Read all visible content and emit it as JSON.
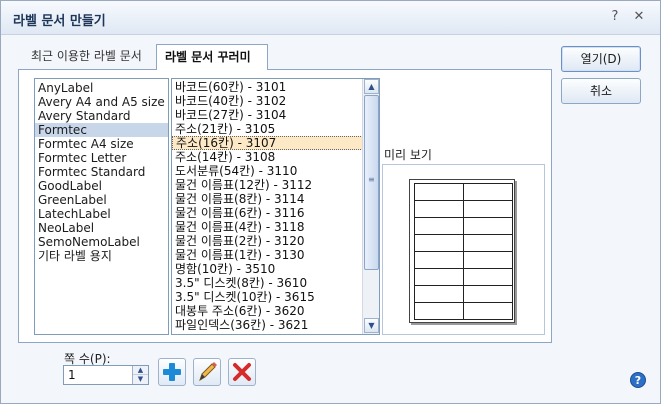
{
  "window": {
    "title": "라벨 문서 만들기",
    "help_glyph": "?",
    "close_glyph": "✕"
  },
  "tabs": {
    "recent": "최근 이용한 라벨 문서",
    "bundle": "라벨 문서 꾸러미"
  },
  "vendors": {
    "items": [
      "AnyLabel",
      "Avery A4 and A5 size",
      "Avery Standard",
      "Formtec",
      "Formtec A4 size",
      "Formtec Letter",
      "Formtec Standard",
      "GoodLabel",
      "GreenLabel",
      "LatechLabel",
      "NeoLabel",
      "SemoNemoLabel",
      "기타 라벨 용지"
    ],
    "selected": "Formtec"
  },
  "products": {
    "items": [
      "바코드(60칸) - 3101",
      "바코드(40칸) - 3102",
      "바코드(27칸) - 3104",
      "주소(21칸) - 3105",
      "주소(16칸) - 3107",
      "주소(14칸) - 3108",
      "도서분류(54칸) - 3110",
      "물건 이름표(12칸) - 3112",
      "물건 이름표(8칸) - 3114",
      "물건 이름표(6칸) - 3116",
      "물건 이름표(4칸) - 3118",
      "물건 이름표(2칸) - 3120",
      "물건 이름표(1칸) - 3130",
      "명함(10칸) - 3510",
      "3.5\" 디스켓(8칸) - 3610",
      "3.5\" 디스켓(10칸) - 3615",
      "대봉투 주소(6칸) - 3620",
      "파일인덱스(36칸) - 3621"
    ],
    "selected": "주소(16칸) - 3107",
    "scroll_up_glyph": "▲",
    "scroll_down_glyph": "▼",
    "scroll_grip": "≡"
  },
  "preview": {
    "label": "미리 보기",
    "columns": 2,
    "rows": 8
  },
  "buttons": {
    "open": "열기(D)",
    "cancel": "취소"
  },
  "count": {
    "label": "쪽 수(P):",
    "value": "1",
    "up_glyph": "▲",
    "down_glyph": "▼"
  },
  "tools": {
    "add": "plus-icon",
    "edit": "pencil-icon",
    "delete": "delete-x-icon"
  },
  "help": {
    "glyph": "?"
  },
  "colors": {
    "accent": "#2d6fc4",
    "selection": "#c8d6ea",
    "focus_item": "#fde9c6",
    "add": "#1c8ad6",
    "delete": "#d62b2b"
  }
}
